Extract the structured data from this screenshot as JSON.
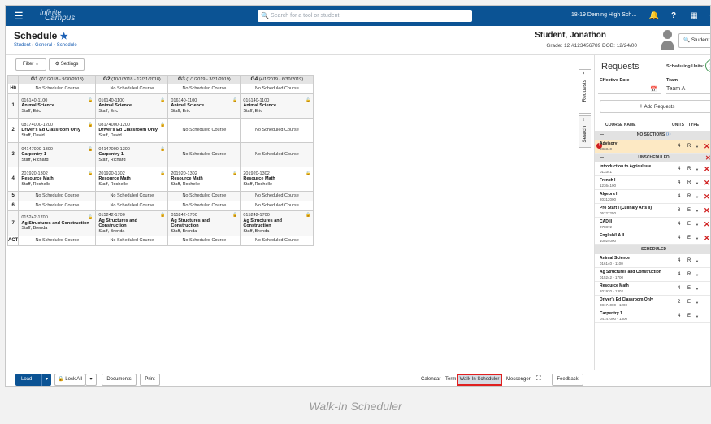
{
  "topbar": {
    "logo_top": "Infinite",
    "logo_bottom": "Campus",
    "search_placeholder": "Search for a tool or student",
    "school": "18-19 Deming High Sch..."
  },
  "header": {
    "title": "Schedule",
    "breadcrumb": "Student  ›  General  ›  Schedule",
    "student_name": "Student, Jonathon",
    "student_info": "Grade: 12  #123456789  DOB: 12/24/00",
    "student_button": "Student"
  },
  "toolbar": {
    "filter": "Filter",
    "settings": "Settings"
  },
  "grid": {
    "columns": [
      {
        "term": "G1",
        "dates": "(7/1/2018 - 9/30/2018)"
      },
      {
        "term": "G2",
        "dates": "(10/1/2018 - 12/31/2018)"
      },
      {
        "term": "G3",
        "dates": "(1/1/2019 - 3/31/2019)"
      },
      {
        "term": "G4",
        "dates": "(4/1/2019 - 6/30/2019)"
      }
    ],
    "rows": [
      {
        "period": "H0",
        "cells": [
          null,
          null,
          null,
          null
        ]
      },
      {
        "period": "1",
        "cells": [
          {
            "sec": "016140-1100",
            "name": "Animal Science",
            "teacher": "Staff, Eric"
          },
          {
            "sec": "016140-1100",
            "name": "Animal Science",
            "teacher": "Staff, Eric"
          },
          {
            "sec": "016140-1100",
            "name": "Animal Science",
            "teacher": "Staff, Eric"
          },
          {
            "sec": "016140-1100",
            "name": "Animal Science",
            "teacher": "Staff, Eric"
          }
        ]
      },
      {
        "period": "2",
        "cells": [
          {
            "sec": "08174000-1200",
            "name": "Driver's Ed Classroom Only",
            "teacher": "Staff, David"
          },
          {
            "sec": "08174000-1200",
            "name": "Driver's Ed Classroom Only",
            "teacher": "Staff, David"
          },
          null,
          null
        ]
      },
      {
        "period": "3",
        "cells": [
          {
            "sec": "04147000-1300",
            "name": "Carpentry 1",
            "teacher": "Staff, Richard"
          },
          {
            "sec": "04147000-1300",
            "name": "Carpentry 1",
            "teacher": "Staff, Richard"
          },
          null,
          null
        ]
      },
      {
        "period": "4",
        "cells": [
          {
            "sec": "201920-1302",
            "name": "Resource Math",
            "teacher": "Staff, Rochelle"
          },
          {
            "sec": "201920-1302",
            "name": "Resource Math",
            "teacher": "Staff, Rochelle"
          },
          {
            "sec": "201920-1302",
            "name": "Resource Math",
            "teacher": "Staff, Rochelle"
          },
          {
            "sec": "201920-1302",
            "name": "Resource Math",
            "teacher": "Staff, Rochelle"
          }
        ]
      },
      {
        "period": "5",
        "cells": [
          null,
          null,
          null,
          null
        ]
      },
      {
        "period": "6",
        "cells": [
          null,
          null,
          null,
          null
        ]
      },
      {
        "period": "7",
        "cells": [
          {
            "sec": "015242-1700",
            "name": "Ag Structures and Construction",
            "teacher": "Staff, Brenda"
          },
          {
            "sec": "015242-1700",
            "name": "Ag Structures and Construction",
            "teacher": "Staff, Brenda"
          },
          {
            "sec": "015242-1700",
            "name": "Ag Structures and Construction",
            "teacher": "Staff, Brenda"
          },
          {
            "sec": "015242-1700",
            "name": "Ag Structures and Construction",
            "teacher": "Staff, Brenda"
          }
        ]
      },
      {
        "period": "ACT",
        "cells": [
          null,
          null,
          null,
          null
        ]
      }
    ],
    "empty_label": "No Scheduled Course"
  },
  "bottombar": {
    "load": "Load",
    "lock_all": "Lock All",
    "documents": "Documents",
    "print": "Print",
    "calendar": "Calendar",
    "term": "Term",
    "walkin": "Walk-In Scheduler",
    "messenger": "Messenger",
    "feedback": "Feedback"
  },
  "sidetabs": {
    "requests": "Requests",
    "search": "Search"
  },
  "panel": {
    "title": "Requests",
    "units_label": "Scheduling Units:",
    "units_badge_top": "50",
    "units_badge_bottom": "28",
    "effective_date_label": "Effective Date",
    "team_label": "Team",
    "team_value": "Team A",
    "add_requests": "Add Requests",
    "col_course": "COURSE NAME",
    "col_units": "UNITS",
    "col_type": "TYPE",
    "no_sections": {
      "label": "NO SECTIONS",
      "items": [
        {
          "name": "Advisory",
          "num": "083340",
          "units": "4",
          "type": "R"
        }
      ]
    },
    "unscheduled": {
      "label": "UNSCHEDULED",
      "items": [
        {
          "name": "Introduction to Agriculture",
          "num": "013341",
          "units": "4",
          "type": "R"
        },
        {
          "name": "French I",
          "num": "12364100",
          "units": "4",
          "type": "R"
        },
        {
          "name": "Algebra I",
          "num": "20312000",
          "units": "4",
          "type": "R"
        },
        {
          "name": "Pro Start I (Culinary Arts II)",
          "num": "05227250",
          "units": "8",
          "type": "E"
        },
        {
          "name": "CAD II",
          "num": "078872",
          "units": "4",
          "type": "E"
        },
        {
          "name": "English/LA II",
          "num": "10024000",
          "units": "4",
          "type": "E"
        }
      ]
    },
    "scheduled": {
      "label": "SCHEDULED",
      "items": [
        {
          "name": "Animal Science",
          "num": "016140 - 1100",
          "units": "4",
          "type": "R"
        },
        {
          "name": "Ag Structures and Construction",
          "num": "015242 - 1700",
          "units": "4",
          "type": "R"
        },
        {
          "name": "Resource Math",
          "num": "201920 - 1302",
          "units": "4",
          "type": "E"
        },
        {
          "name": "Driver's Ed Classroom Only",
          "num": "08174000 - 1200",
          "units": "2",
          "type": "E"
        },
        {
          "name": "Carpentry 1",
          "num": "04147000 - 1300",
          "units": "4",
          "type": "E"
        }
      ]
    }
  },
  "caption": "Walk-In Scheduler"
}
